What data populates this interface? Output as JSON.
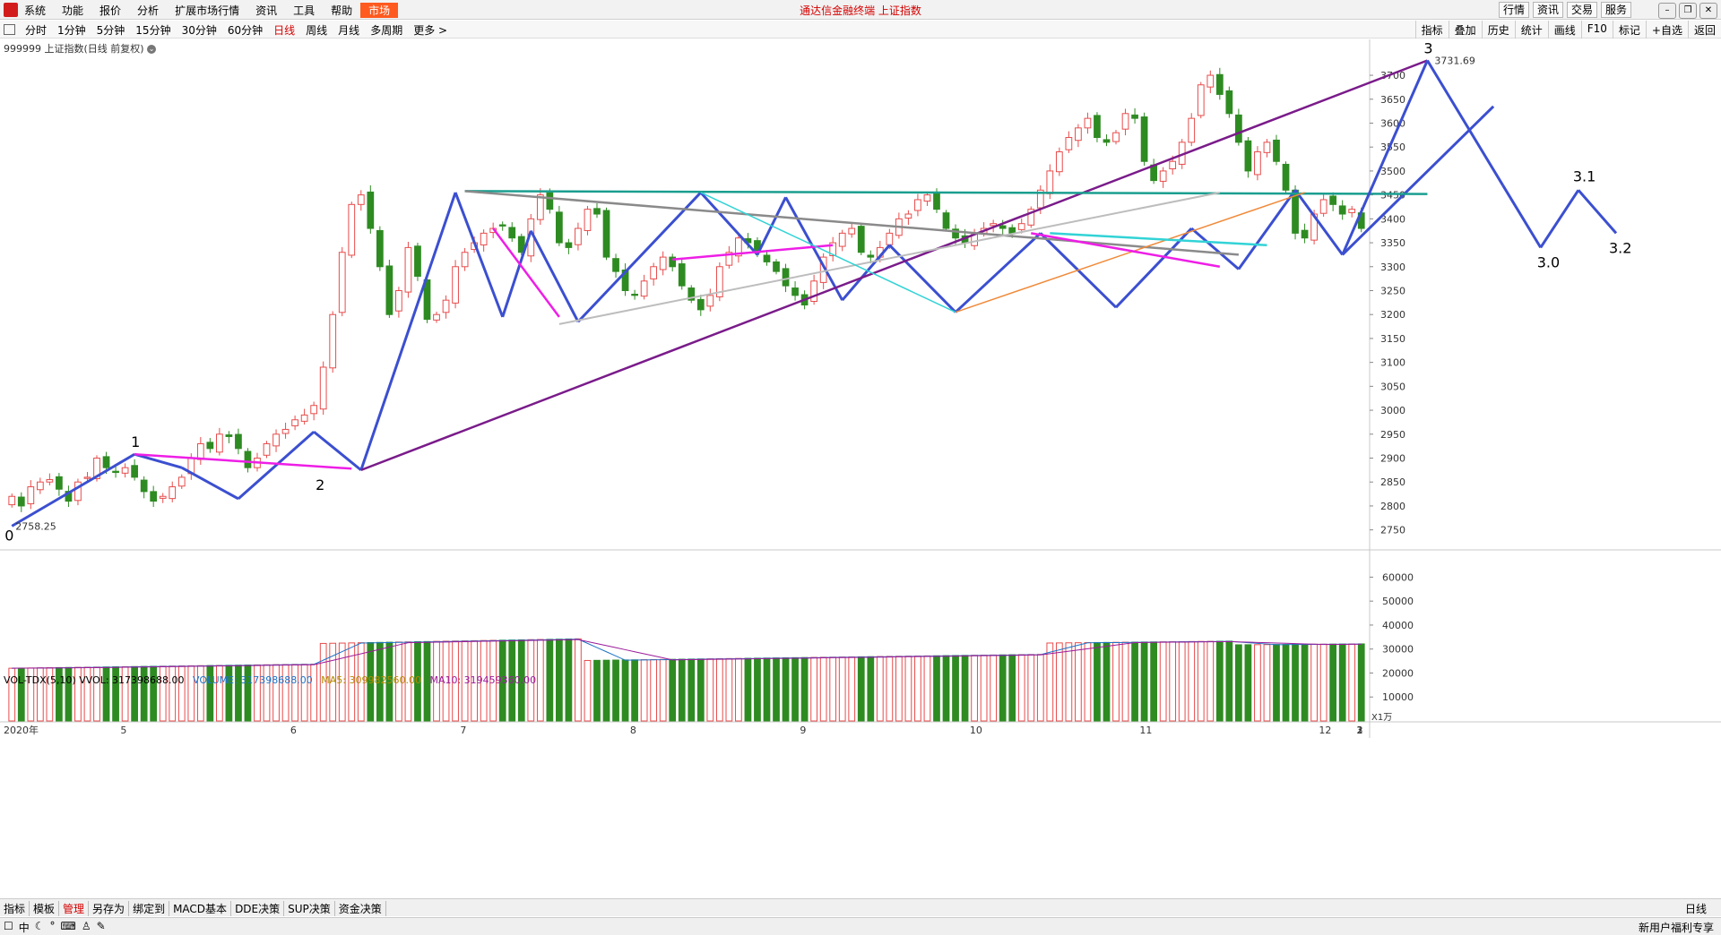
{
  "menu": {
    "items": [
      "系统",
      "功能",
      "报价",
      "分析",
      "扩展市场行情",
      "资讯",
      "工具",
      "帮助"
    ],
    "highlight": "市场",
    "title": "通达信金融终端  上证指数",
    "right_buttons": [
      "行情",
      "资讯",
      "交易",
      "服务"
    ]
  },
  "toolbar": {
    "periods": [
      "分时",
      "1分钟",
      "5分钟",
      "15分钟",
      "30分钟",
      "60分钟",
      "日线",
      "周线",
      "月线",
      "多周期",
      "更多 >"
    ],
    "selected_period": "日线",
    "right_tools": [
      "指标",
      "叠加",
      "历史",
      "统计",
      "画线",
      "F10",
      "标记",
      "+自选",
      "返回"
    ]
  },
  "chart_header": {
    "title": "999999 上证指数(日线 前复权)"
  },
  "chart_data": {
    "type": "candlestick",
    "y_ticks": [
      3700,
      3650,
      3600,
      3550,
      3500,
      3450,
      3400,
      3350,
      3300,
      3250,
      3200,
      3150,
      3100,
      3050,
      3000,
      2950,
      2900,
      2850,
      2800,
      2750
    ],
    "ylim": [
      2725,
      3760
    ],
    "x_month_labels": [
      "2020年",
      "5",
      "6",
      "7",
      "8",
      "9",
      "10",
      "11",
      "12",
      "1",
      "2",
      "3"
    ],
    "annotations": {
      "low": "2758.25",
      "high": "3731.69",
      "wave_labels": [
        "0",
        "1",
        "2",
        "3",
        "3.0",
        "3.1",
        "3.2"
      ]
    },
    "close_path": [
      2820,
      2800,
      2840,
      2850,
      2855,
      2835,
      2810,
      2850,
      2860,
      2900,
      2880,
      2870,
      2880,
      2860,
      2830,
      2810,
      2820,
      2840,
      2860,
      2900,
      2930,
      2920,
      2950,
      2945,
      2920,
      2880,
      2900,
      2930,
      2950,
      2960,
      2980,
      2990,
      3010,
      3090,
      3200,
      3330,
      3430,
      3450,
      3380,
      3300,
      3200,
      3250,
      3340,
      3280,
      3190,
      3200,
      3230,
      3300,
      3330,
      3350,
      3370,
      3380,
      3385,
      3360,
      3330,
      3400,
      3450,
      3420,
      3350,
      3340,
      3380,
      3420,
      3410,
      3320,
      3290,
      3250,
      3240,
      3270,
      3300,
      3320,
      3300,
      3260,
      3230,
      3210,
      3240,
      3300,
      3330,
      3360,
      3350,
      3330,
      3310,
      3290,
      3260,
      3240,
      3220,
      3270,
      3320,
      3350,
      3370,
      3380,
      3330,
      3320,
      3340,
      3370,
      3400,
      3410,
      3440,
      3450,
      3420,
      3380,
      3360,
      3350,
      3370,
      3380,
      3390,
      3380,
      3370,
      3390,
      3420,
      3460,
      3500,
      3540,
      3570,
      3590,
      3610,
      3570,
      3560,
      3580,
      3620,
      3610,
      3520,
      3480,
      3500,
      3520,
      3560,
      3610,
      3680,
      3700,
      3660,
      3620,
      3560,
      3500,
      3540,
      3560,
      3520,
      3460,
      3370,
      3360,
      3410,
      3440,
      3430,
      3410,
      3420,
      3380
    ]
  },
  "volume": {
    "indicator": "VOL-TDX(5,10)",
    "vvol": "VVOL: 317398688.00",
    "volume": "VOLUME: 317398688.00",
    "ma5": "MA5: 309982560.00",
    "ma10": "MA10: 319459360.00",
    "y_ticks": [
      60000,
      50000,
      40000,
      30000,
      20000,
      10000
    ],
    "unit": "X1万"
  },
  "colors": {
    "up": "#e84c4c",
    "down": "#2e8b22",
    "wave_blue": "#3b4fd0",
    "magenta": "#ee1ee6",
    "purple": "#7a1b8a",
    "teal": "#1a9e8f",
    "gray": "#8a8a8a",
    "orange": "#f08a3a",
    "cyan": "#32d3d6"
  },
  "bottom_tabs": [
    "指标",
    "模板",
    "管理",
    "另存为",
    "绑定到",
    "MACD基本",
    "DDE决策",
    "SUP决策",
    "资金决策"
  ],
  "selected_tab": "管理",
  "period_label": "日线",
  "status": {
    "right": "新用户福利专享"
  }
}
